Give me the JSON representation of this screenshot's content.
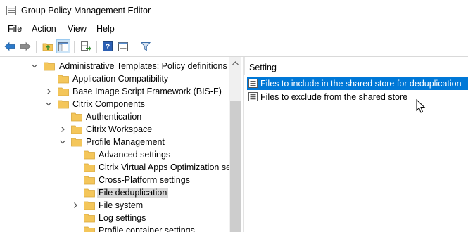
{
  "window": {
    "title": "Group Policy Management Editor"
  },
  "menu": {
    "items": [
      "File",
      "Action",
      "View",
      "Help"
    ]
  },
  "toolbar": {
    "buttons": [
      "back-icon",
      "forward-icon",
      "up-folder-icon",
      "show-hide-tree-icon",
      "export-list-icon",
      "help-icon",
      "properties-icon",
      "filter-icon"
    ]
  },
  "tree": {
    "items": [
      {
        "label": "Administrative Templates: Policy definitions (A",
        "expanded": true
      },
      {
        "label": "Application Compatibility"
      },
      {
        "label": "Base Image Script Framework (BIS-F)",
        "expanded": false
      },
      {
        "label": "Citrix Components",
        "expanded": true
      },
      {
        "label": "Authentication"
      },
      {
        "label": "Citrix Workspace",
        "expanded": false
      },
      {
        "label": "Profile Management",
        "expanded": true
      },
      {
        "label": "Advanced settings"
      },
      {
        "label": "Citrix Virtual Apps Optimization set"
      },
      {
        "label": "Cross-Platform settings"
      },
      {
        "label": "File deduplication",
        "selected": true
      },
      {
        "label": "File system",
        "expanded": false
      },
      {
        "label": "Log settings"
      },
      {
        "label": "Profile container settings"
      }
    ]
  },
  "list": {
    "header": "Setting",
    "rows": [
      {
        "label": "Files to include in the shared store for deduplication",
        "selected": true
      },
      {
        "label": "Files to exclude from the shared store"
      }
    ]
  },
  "colors": {
    "selection": "#0078d7",
    "tree_selection": "#d9d9d9",
    "folder": "#f4c65a"
  }
}
